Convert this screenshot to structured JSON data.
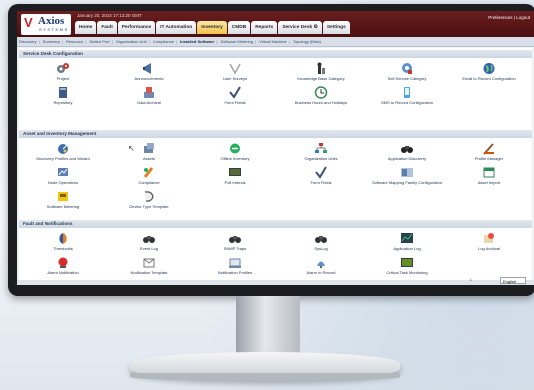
{
  "header": {
    "logo_name": "Axios",
    "logo_sub": "SYSTEMS",
    "datetime": "January 20, 2014 17:13:20 GMT",
    "preferences": "Preferences | Logout"
  },
  "tabs": [
    {
      "label": "Home"
    },
    {
      "label": "Fault"
    },
    {
      "label": "Performance"
    },
    {
      "label": "IT Automation"
    },
    {
      "label": "Inventory",
      "active": true
    },
    {
      "label": "CMDB"
    },
    {
      "label": "Reports"
    },
    {
      "label": "Service Desk ⚙"
    },
    {
      "label": "Settings"
    }
  ],
  "subnav": [
    "Discovery",
    "Summary",
    "Resource",
    "Switch Port",
    "Organization Unit",
    "Compliance",
    "Installed Software",
    "Software Metering",
    "Virtual Machine",
    "Topology (Beta)"
  ],
  "subnav_active": "Installed Software",
  "sections": {
    "service_desk": {
      "title": "Service Desk Configuration",
      "items": [
        {
          "label": "Project",
          "icon": "gears-icon"
        },
        {
          "label": "Announcements",
          "icon": "megaphone-icon"
        },
        {
          "label": "User Surveys",
          "icon": "survey-icon"
        },
        {
          "label": "Knowledge Base Category",
          "icon": "chess-icon"
        },
        {
          "label": "Self Service Category",
          "icon": "support-icon"
        },
        {
          "label": "Email to Record Configuration",
          "icon": "globe-icon"
        },
        {
          "label": "Repository",
          "icon": "book-icon"
        },
        {
          "label": "Data Archival",
          "icon": "archive-icon"
        },
        {
          "label": "Form Fields",
          "icon": "check-icon"
        },
        {
          "label": "Business Hours and Holidays",
          "icon": "clock-icon"
        },
        {
          "label": "SMS to Record Configuration",
          "icon": "sms-icon"
        }
      ]
    },
    "asset": {
      "title": "Asset and Inventory Management",
      "items": [
        {
          "label": "Discovery Profiles and Wizard",
          "icon": "radar-icon"
        },
        {
          "label": "Assets",
          "icon": "assets-icon"
        },
        {
          "label": "Offline Inventory",
          "icon": "offline-icon"
        },
        {
          "label": "Organization Units",
          "icon": "org-icon"
        },
        {
          "label": "Application Discovery",
          "icon": "binoculars-icon"
        },
        {
          "label": "Profile Manager",
          "icon": "profile-icon"
        },
        {
          "label": "Node Operations",
          "icon": "node-icon"
        },
        {
          "label": "Compliance",
          "icon": "compliance-icon"
        },
        {
          "label": "Poll Interval",
          "icon": "monitor-icon"
        },
        {
          "label": "Form Fields",
          "icon": "check-icon"
        },
        {
          "label": "Software Mapping Family Configuration",
          "icon": "mapping-icon"
        },
        {
          "label": "Asset Import",
          "icon": "import-icon"
        },
        {
          "label": "Software Metering",
          "icon": "meter-icon"
        },
        {
          "label": "Device Type Template",
          "icon": "template-icon"
        }
      ]
    },
    "fault": {
      "title": "Fault and Notifications",
      "items": [
        {
          "label": "Thresholds",
          "icon": "threshold-icon"
        },
        {
          "label": "Event Log",
          "icon": "eventlog-icon"
        },
        {
          "label": "SNMP Traps",
          "icon": "traps-icon"
        },
        {
          "label": "SysLog",
          "icon": "syslog-icon"
        },
        {
          "label": "Application Log",
          "icon": "applog-icon"
        },
        {
          "label": "Log Archival",
          "icon": "logarchive-icon"
        },
        {
          "label": "Alarm Notification",
          "icon": "alarm-icon"
        },
        {
          "label": "Notification Template",
          "icon": "notiftemplate-icon"
        },
        {
          "label": "Notification Profiles",
          "icon": "notifprofile-icon"
        },
        {
          "label": "Alarm to Record",
          "icon": "alarmrecord-icon"
        },
        {
          "label": "Critical Task Monitoring",
          "icon": "critical-icon"
        }
      ]
    }
  },
  "footer": {
    "page": "1",
    "language": "English"
  },
  "colors": {
    "header_bg": "#5a1516",
    "active_tab": "#f0c14b",
    "section_head": "#cdd6e2"
  }
}
